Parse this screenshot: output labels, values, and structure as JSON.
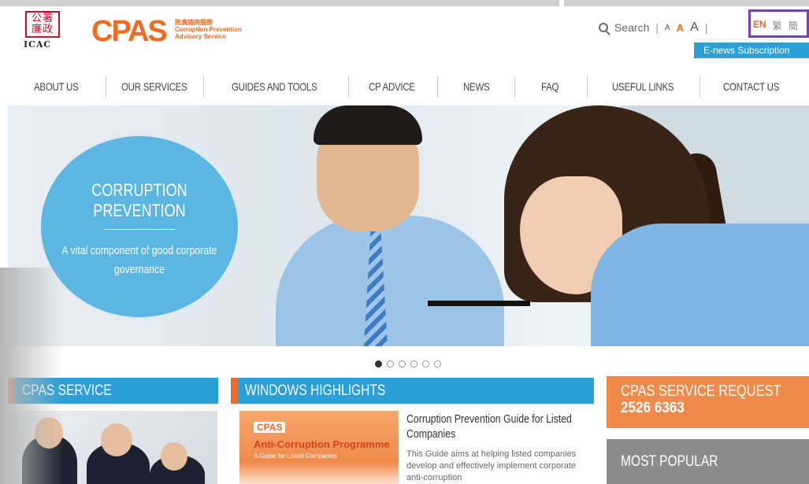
{
  "header": {
    "icac_logo_chinese": "公署 廉政",
    "icac_logo_text": "ICAC",
    "cpas_logo": "CPAS",
    "cpas_tagline_cn": "防貪諮詢服務",
    "cpas_tagline_en": "Corruption Prevention Advisory Service"
  },
  "utility": {
    "search_label": "Search",
    "font_small": "A",
    "font_medium": "A",
    "font_large": "A",
    "lang_en": "EN",
    "lang_tc": "繁",
    "lang_sc": "簡",
    "enews_label": "E-news Subscription"
  },
  "nav": {
    "items": [
      {
        "label": "ABOUT US"
      },
      {
        "label": "OUR SERVICES"
      },
      {
        "label": "GUIDES AND TOOLS"
      },
      {
        "label": "CP ADVICE"
      },
      {
        "label": "NEWS"
      },
      {
        "label": "FAQ"
      },
      {
        "label": "USEFUL LINKS"
      },
      {
        "label": "CONTACT US"
      }
    ]
  },
  "hero": {
    "title": "CORRUPTION PREVENTION",
    "subtitle": "A vital component of good corporate governance",
    "slide_count": 6,
    "active_slide": 1
  },
  "panels": {
    "cpas_service": "CPAS SERVICE",
    "windows_highlights": "WINDOWS HIGHLIGHTS",
    "service_request_title": "CPAS SERVICE REQUEST",
    "service_request_phone": "2526 6363",
    "most_popular": "MOST POPULAR"
  },
  "highlight": {
    "book_logo": "CPAS",
    "book_title": "Anti-Corruption Programme",
    "book_subtitle": "A Guide for Listed Companies",
    "title": "Corruption Prevention Guide for Listed Companies",
    "text": "This Guide aims at helping listed companies develop and effectively implement corporate anti-corruption"
  },
  "colors": {
    "brand_orange": "#f26a21",
    "brand_blue": "#2b9fd8",
    "lang_highlight": "#7a3fb2"
  }
}
